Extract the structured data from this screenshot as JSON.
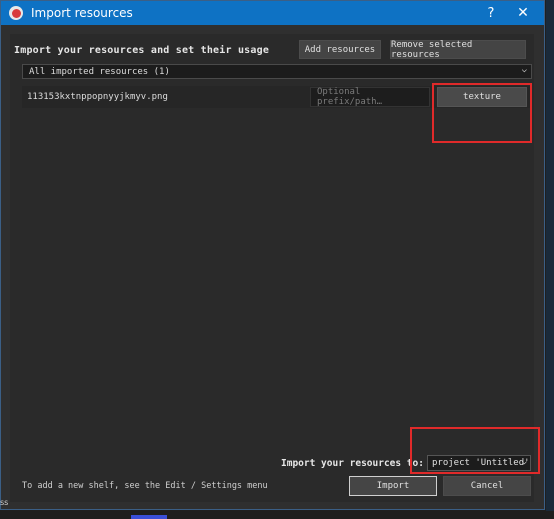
{
  "window": {
    "title": "Import resources",
    "help_label": "?",
    "close_label": "✕",
    "accent_color": "#0e72c4"
  },
  "header": {
    "heading": "Import your resources and set their usage",
    "add_label": "Add resources",
    "remove_label": "Remove selected resources"
  },
  "filter": {
    "selected": "All imported resources (1)"
  },
  "files": [
    {
      "name": "113153kxtnppopnyyjkmyv.png",
      "prefix_placeholder": "Optional prefix/path…",
      "usage": "texture"
    }
  ],
  "footer": {
    "import_to_label": "Import your resources to:",
    "target": "project 'Untitled'",
    "hint": "To add a new shelf, see the Edit / Settings menu",
    "import_label": "Import",
    "cancel_label": "Cancel"
  },
  "highlight_color": "#e02a2a",
  "edge_text": "ss"
}
